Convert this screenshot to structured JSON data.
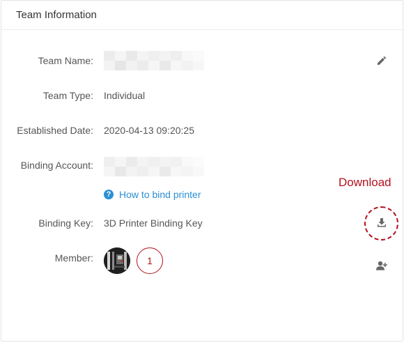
{
  "header": {
    "title": "Team Information"
  },
  "fields": {
    "team_name": {
      "label": "Team Name:"
    },
    "team_type": {
      "label": "Team Type:",
      "value": "Individual"
    },
    "established": {
      "label": "Established Date:",
      "value": "2020-04-13 09:20:25"
    },
    "binding_account": {
      "label": "Binding Account:"
    },
    "binding_key": {
      "label": "Binding Key:",
      "value": "3D Printer Binding Key"
    },
    "member": {
      "label": "Member:",
      "count": "1"
    }
  },
  "help_link": {
    "text": "How to bind printer",
    "icon": "question-icon"
  },
  "annotation": {
    "text": "Download"
  },
  "icons": {
    "edit": "pencil-icon",
    "download": "download-icon",
    "add_member": "add-user-icon"
  },
  "colors": {
    "accent_red": "#b4111e",
    "link_blue": "#2a8fd4",
    "icon_gray": "#666666"
  }
}
